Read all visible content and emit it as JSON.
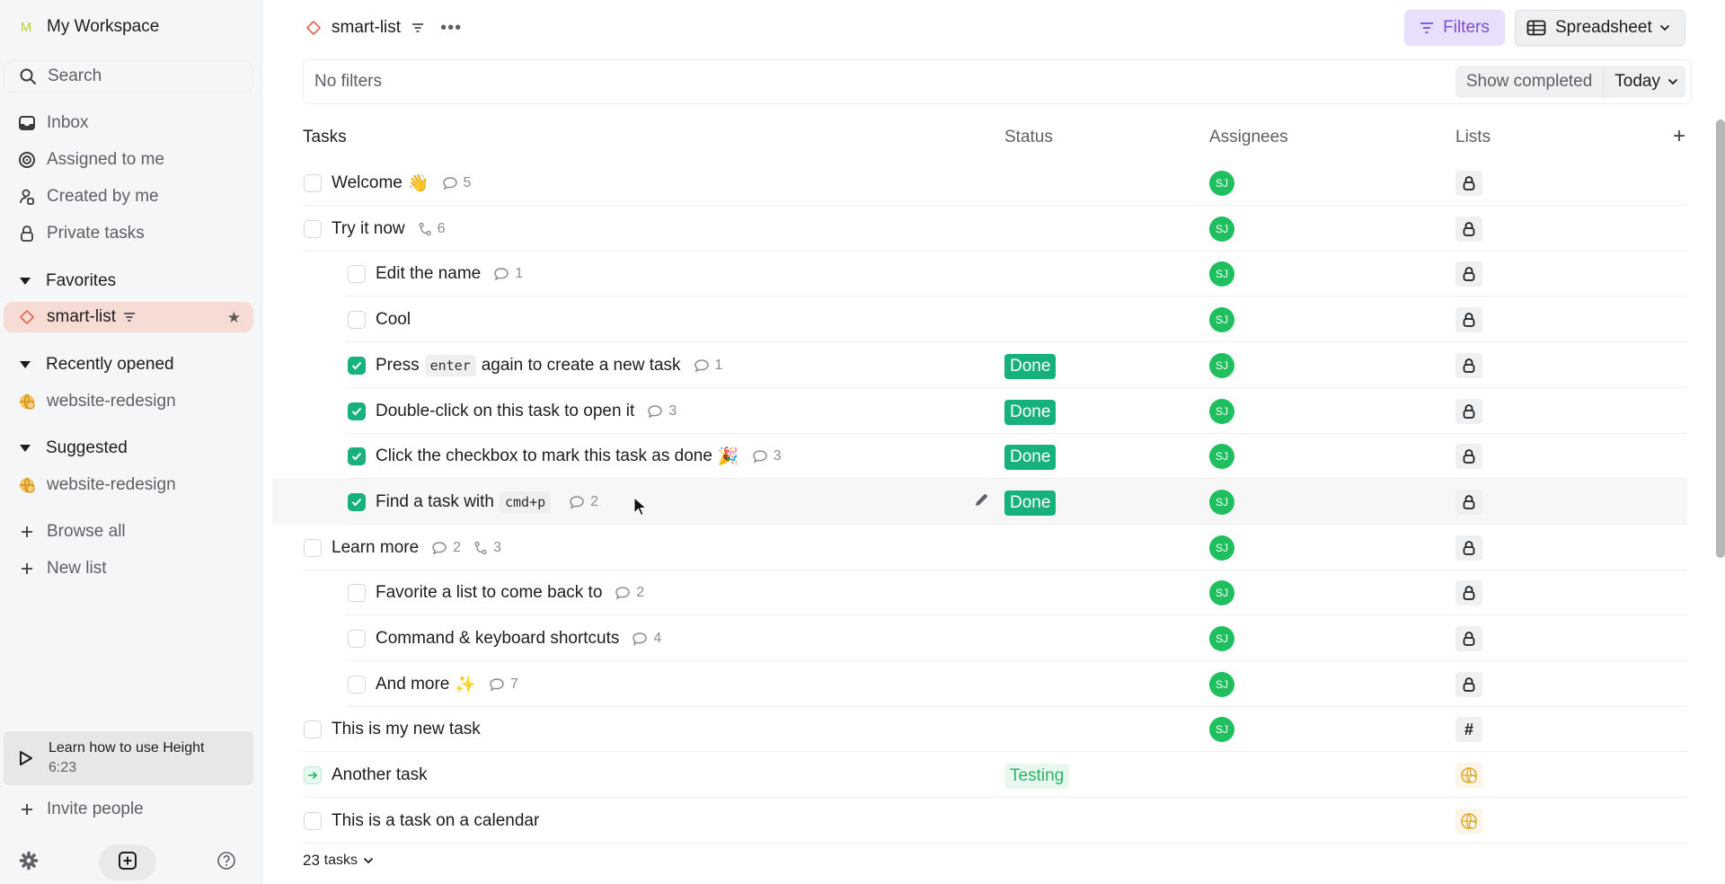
{
  "sidebar": {
    "workspace_initial": "M",
    "workspace_name": "My Workspace",
    "search_label": "Search",
    "nav": [
      {
        "label": "Inbox",
        "icon": "inbox-icon"
      },
      {
        "label": "Assigned to me",
        "icon": "target-icon"
      },
      {
        "label": "Created by me",
        "icon": "user-created-icon"
      },
      {
        "label": "Private tasks",
        "icon": "lock-icon"
      }
    ],
    "favorites_title": "Favorites",
    "favorites": [
      {
        "label": "smart-list",
        "icon": "diamond-icon",
        "starred": true
      }
    ],
    "recent_title": "Recently opened",
    "recent": [
      {
        "label": "website-redesign",
        "icon": "globe-icon"
      }
    ],
    "suggested_title": "Suggested",
    "suggested": [
      {
        "label": "website-redesign",
        "icon": "globe-icon"
      }
    ],
    "browse_all": "Browse all",
    "new_list": "New list",
    "learn": {
      "title": "Learn how to use Height",
      "duration": "6:23"
    },
    "invite": "Invite people"
  },
  "header": {
    "title": "smart-list",
    "filters_label": "Filters",
    "view_label": "Spreadsheet"
  },
  "filterbar": {
    "text": "No filters",
    "show_completed": "Show completed",
    "period": "Today"
  },
  "columns": {
    "tasks": "Tasks",
    "status": "Status",
    "assignees": "Assignees",
    "lists": "Lists",
    "add": "+"
  },
  "tasks": [
    {
      "name": "Welcome",
      "emoji": "👋",
      "comments": "5",
      "subtasks": null,
      "level": 0,
      "state": "open",
      "status": "",
      "assignee": "SJ",
      "list": "lock"
    },
    {
      "name": "Try it now",
      "emoji": "",
      "comments": null,
      "subtasks": "6",
      "level": 0,
      "state": "open",
      "status": "",
      "assignee": "SJ",
      "list": "lock"
    },
    {
      "name": "Edit the name",
      "emoji": "",
      "comments": "1",
      "subtasks": null,
      "level": 1,
      "state": "open",
      "status": "",
      "assignee": "SJ",
      "list": "lock"
    },
    {
      "name": "Cool",
      "emoji": "",
      "comments": null,
      "subtasks": null,
      "level": 1,
      "state": "open",
      "status": "",
      "assignee": "SJ",
      "list": "lock"
    },
    {
      "name_pre": "Press",
      "kbd": "enter",
      "name_post": "again to create a new task",
      "emoji": "",
      "comments": "1",
      "subtasks": null,
      "level": 1,
      "state": "done",
      "status": "Done",
      "assignee": "SJ",
      "list": "lock"
    },
    {
      "name": "Double-click on this task to open it",
      "emoji": "",
      "comments": "3",
      "subtasks": null,
      "level": 1,
      "state": "done",
      "status": "Done",
      "assignee": "SJ",
      "list": "lock"
    },
    {
      "name": "Click the checkbox to mark this task as done",
      "emoji": "🎉",
      "comments": "3",
      "subtasks": null,
      "level": 1,
      "state": "done",
      "status": "Done",
      "assignee": "SJ",
      "list": "lock"
    },
    {
      "name_pre": "Find a task with",
      "kbd": "cmd+p",
      "name_post": "",
      "emoji": "",
      "comments": "2",
      "subtasks": null,
      "level": 1,
      "state": "done",
      "status": "Done",
      "assignee": "SJ",
      "list": "lock",
      "hover": true
    },
    {
      "name": "Learn more",
      "emoji": "",
      "comments": "2",
      "subtasks": "3",
      "level": 0,
      "state": "open",
      "status": "",
      "assignee": "SJ",
      "list": "lock"
    },
    {
      "name": "Favorite a list to come back to",
      "emoji": "",
      "comments": "2",
      "subtasks": null,
      "level": 1,
      "state": "open",
      "status": "",
      "assignee": "SJ",
      "list": "lock"
    },
    {
      "name": "Command & keyboard shortcuts",
      "emoji": "",
      "comments": "4",
      "subtasks": null,
      "level": 1,
      "state": "open",
      "status": "",
      "assignee": "SJ",
      "list": "lock"
    },
    {
      "name": "And more",
      "emoji": "✨",
      "comments": "7",
      "subtasks": null,
      "level": 1,
      "state": "open",
      "status": "",
      "assignee": "SJ",
      "list": "lock"
    },
    {
      "name": "This is my new task",
      "emoji": "",
      "comments": null,
      "subtasks": null,
      "level": 0,
      "state": "open",
      "status": "",
      "assignee": "SJ",
      "list": "#"
    },
    {
      "name": "Another task",
      "emoji": "",
      "comments": null,
      "subtasks": null,
      "level": 0,
      "state": "in-progress",
      "status": "Testing",
      "assignee": "",
      "list": "globe"
    },
    {
      "name": "This is a task on a calendar",
      "emoji": "",
      "comments": null,
      "subtasks": null,
      "level": 0,
      "state": "open",
      "status": "",
      "assignee": "",
      "list": "globe"
    }
  ],
  "footer": {
    "count": "23",
    "label": "tasks"
  },
  "colors": {
    "done": "#17b27c",
    "testing": "#2bb56a",
    "filters_accent": "#7b4fd8",
    "favorite_bg": "#f7dcd5",
    "avatar": "#1fbf5f",
    "list_icon": "#e4a72a"
  }
}
